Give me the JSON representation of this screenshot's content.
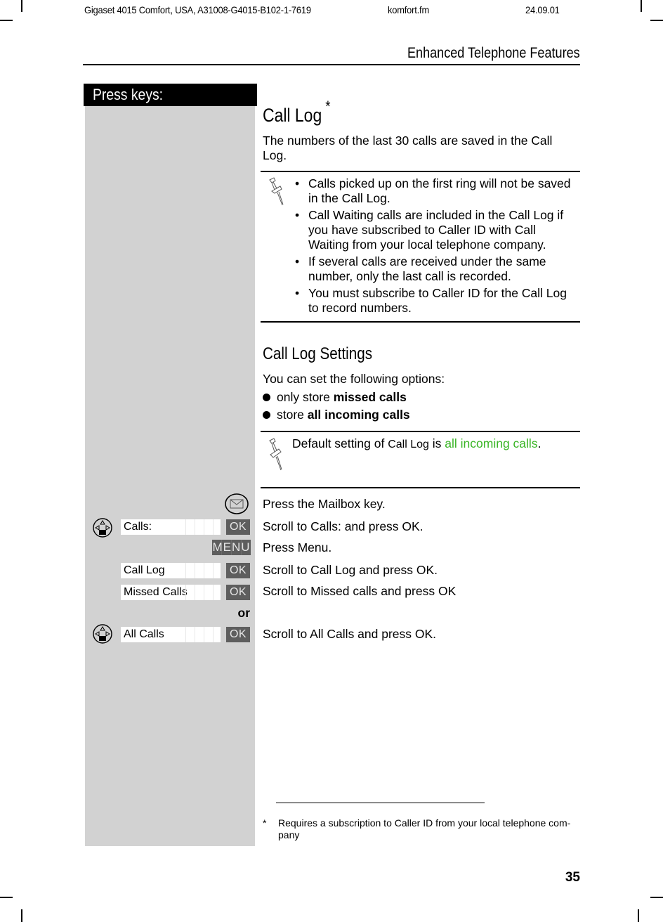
{
  "running_header": {
    "doc_id": "Gigaset 4015 Comfort, USA, A31008-G4015-B102-1-7619",
    "file": "komfort.fm",
    "date": "24.09.01",
    "section_title": "Enhanced Telephone Features"
  },
  "keys_column": {
    "header": "Press keys:"
  },
  "call_log": {
    "title": "Call Log",
    "title_marker": "*",
    "intro": "The numbers of the last 30 calls are saved in the Call Log.",
    "notes_icon": "pushpin-icon",
    "notes": [
      "Calls picked up on the first ring will not be saved in the Call Log.",
      "Call Waiting calls are included in the Call Log if you have subscribed to Caller ID with Call Waiting from your local telephone company.",
      "If several calls are received under the same number, only the last call is recorded.",
      "You must subscribe to Caller ID for the Call Log to record numbers."
    ]
  },
  "settings": {
    "title": "Call Log Settings",
    "intro": "You can set the following options:",
    "options": [
      {
        "prefix": "only store ",
        "bold": "missed calls"
      },
      {
        "prefix": "store ",
        "bold": "all incoming calls"
      }
    ],
    "default_note": {
      "icon": "pushpin-icon",
      "prefix": "Default setting of ",
      "menu_item": "Call Log",
      "middle": " is ",
      "value": "all incoming calls",
      "suffix": ".",
      "value_color": "#3ab526"
    }
  },
  "steps": [
    {
      "key_icon": "mailbox-key-icon",
      "display": null,
      "softkey": null,
      "text": "Press the Mailbox key."
    },
    {
      "key_icon": "navigation-key-icon",
      "display": "Calls:",
      "softkey": "OK",
      "text": "Scroll to Calls: and press OK."
    },
    {
      "key_icon": null,
      "display": null,
      "softkey": "MENU",
      "text": "Press Menu."
    },
    {
      "key_icon": null,
      "display": "Call Log",
      "softkey": "OK",
      "text": "Scroll to Call Log and press OK."
    },
    {
      "key_icon": null,
      "display": "Missed Calls",
      "softkey": "OK",
      "text": "Scroll to Missed calls and press OK"
    },
    {
      "separator": "or"
    },
    {
      "key_icon": "navigation-key-icon",
      "display": "All Calls",
      "softkey": "OK",
      "text": "Scroll to All Calls and press OK."
    }
  ],
  "footnote": {
    "marker": "*",
    "text": "Requires a subscription to Caller ID from your local telephone com-pany"
  },
  "page_number": "35"
}
